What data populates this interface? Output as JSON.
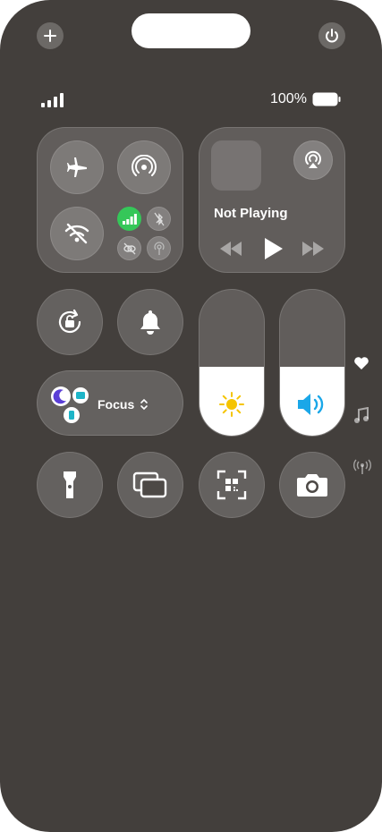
{
  "status": {
    "battery_text": "100%"
  },
  "media": {
    "title": "Not Playing"
  },
  "focus": {
    "label": "Focus"
  },
  "sliders": {
    "brightness_level": 0.47,
    "volume_level": 0.47
  },
  "colors": {
    "background": "#433f3c",
    "cellular_active": "#35c759",
    "volume_accent": "#1aa7e8",
    "brightness_accent": "#f5c400"
  }
}
